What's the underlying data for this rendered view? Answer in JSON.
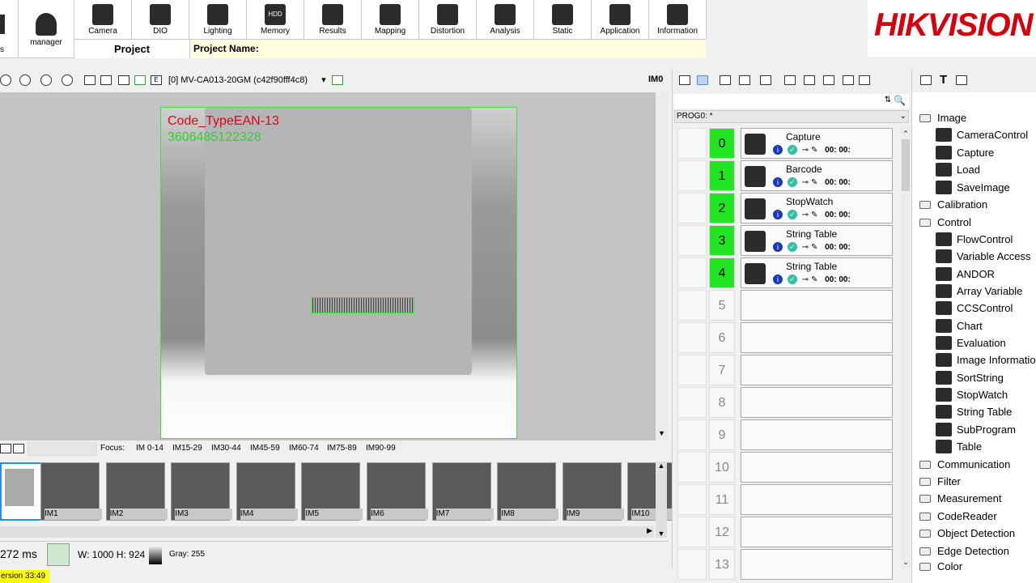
{
  "toolbar": {
    "manager_label": "manager",
    "buttons": [
      {
        "label": "Camera",
        "icon": "camera-icon"
      },
      {
        "label": "DIO",
        "icon": "dio-icon"
      },
      {
        "label": "Lighting",
        "icon": "lighting-icon"
      },
      {
        "label": "Memory",
        "icon": "memory-icon",
        "glyph": "HDD"
      },
      {
        "label": "Results",
        "icon": "results-icon"
      },
      {
        "label": "Mapping",
        "icon": "mapping-icon"
      },
      {
        "label": "Distortion",
        "icon": "distortion-icon"
      },
      {
        "label": "Analysis",
        "icon": "analysis-icon"
      },
      {
        "label": "Static",
        "icon": "static-icon"
      },
      {
        "label": "Application",
        "icon": "application-icon"
      },
      {
        "label": "Information",
        "icon": "information-icon"
      }
    ],
    "left_partial": "s",
    "project_label": "Project",
    "project_name_label": "Project Name:"
  },
  "brand": {
    "logo_text": "HIKVISION"
  },
  "image_toolbar": {
    "camera_select": "[0] MV-CA013-20GM (c42f90fff4c8)",
    "image_id": "IM0",
    "overlay_badge": "E"
  },
  "image_overlay": {
    "code_type": "Code_TypeEAN-13",
    "code_value": "3606485122328"
  },
  "focus_bar": {
    "label": "Focus:",
    "ranges": [
      "IM 0-14",
      "IM15-29",
      "IM30-44",
      "IM45-59",
      "IM60-74",
      "IM75-89",
      "IM90-99"
    ]
  },
  "thumbnails": [
    "",
    "IM1",
    "IM2",
    "IM3",
    "IM4",
    "IM5",
    "IM6",
    "IM7",
    "IM8",
    "IM9",
    "IM10"
  ],
  "status": {
    "time": "272 ms",
    "width_height": "W: 1000  H: 924",
    "gray": "Gray: 255",
    "version": "ersion  33:49"
  },
  "program": {
    "name": "PROG0: *",
    "rows": [
      {
        "num": "0",
        "active": true,
        "name": "Capture",
        "icon": "camera-icon"
      },
      {
        "num": "1",
        "active": true,
        "name": "Barcode",
        "icon": "barcode-icon"
      },
      {
        "num": "2",
        "active": true,
        "name": "StopWatch",
        "icon": "stopwatch-icon"
      },
      {
        "num": "3",
        "active": true,
        "name": "String Table",
        "icon": "table-icon"
      },
      {
        "num": "4",
        "active": true,
        "name": "String Table",
        "icon": "table-icon"
      },
      {
        "num": "5",
        "active": false,
        "name": ""
      },
      {
        "num": "6",
        "active": false,
        "name": ""
      },
      {
        "num": "7",
        "active": false,
        "name": ""
      },
      {
        "num": "8",
        "active": false,
        "name": ""
      },
      {
        "num": "9",
        "active": false,
        "name": ""
      },
      {
        "num": "10",
        "active": false,
        "name": ""
      },
      {
        "num": "11",
        "active": false,
        "name": ""
      },
      {
        "num": "12",
        "active": false,
        "name": ""
      },
      {
        "num": "13",
        "active": false,
        "name": ""
      }
    ],
    "tool_glyphs": "00: 00:"
  },
  "tree": [
    {
      "type": "cat",
      "label": "Image"
    },
    {
      "type": "item",
      "label": "CameraControl",
      "icon": "camera-control-icon"
    },
    {
      "type": "item",
      "label": "Capture",
      "icon": "capture-icon"
    },
    {
      "type": "item",
      "label": "Load",
      "icon": "load-icon"
    },
    {
      "type": "item",
      "label": "SaveImage",
      "icon": "save-image-icon"
    },
    {
      "type": "cat",
      "label": "Calibration"
    },
    {
      "type": "cat",
      "label": "Control"
    },
    {
      "type": "item",
      "label": "FlowControl",
      "icon": "flow-control-icon"
    },
    {
      "type": "item",
      "label": "Variable Access",
      "icon": "variable-access-icon"
    },
    {
      "type": "item",
      "label": "ANDOR",
      "icon": "andor-icon"
    },
    {
      "type": "item",
      "label": "Array Variable",
      "icon": "array-variable-icon"
    },
    {
      "type": "item",
      "label": "CCSControl",
      "icon": "ccs-control-icon"
    },
    {
      "type": "item",
      "label": "Chart",
      "icon": "chart-icon"
    },
    {
      "type": "item",
      "label": "Evaluation",
      "icon": "evaluation-icon"
    },
    {
      "type": "item",
      "label": "Image Information",
      "icon": "image-information-icon"
    },
    {
      "type": "item",
      "label": "SortString",
      "icon": "sort-string-icon"
    },
    {
      "type": "item",
      "label": "StopWatch",
      "icon": "stopwatch-icon"
    },
    {
      "type": "item",
      "label": "String Table",
      "icon": "string-table-icon"
    },
    {
      "type": "item",
      "label": "SubProgram",
      "icon": "subprogram-icon"
    },
    {
      "type": "item",
      "label": "Table",
      "icon": "table-icon"
    },
    {
      "type": "cat",
      "label": "Communication"
    },
    {
      "type": "cat",
      "label": "Filter"
    },
    {
      "type": "cat",
      "label": "Measurement"
    },
    {
      "type": "cat",
      "label": "CodeReader"
    },
    {
      "type": "cat",
      "label": "Object Detection"
    },
    {
      "type": "cat",
      "label": "Edge Detection"
    },
    {
      "type": "cat",
      "label": "Color"
    }
  ],
  "colors": {
    "active_row": "#22e622",
    "overlay_box": "#3fe13f",
    "code_type_text": "#e0001a",
    "brand_red": "#d7000f",
    "version_bg": "#ffff00"
  }
}
